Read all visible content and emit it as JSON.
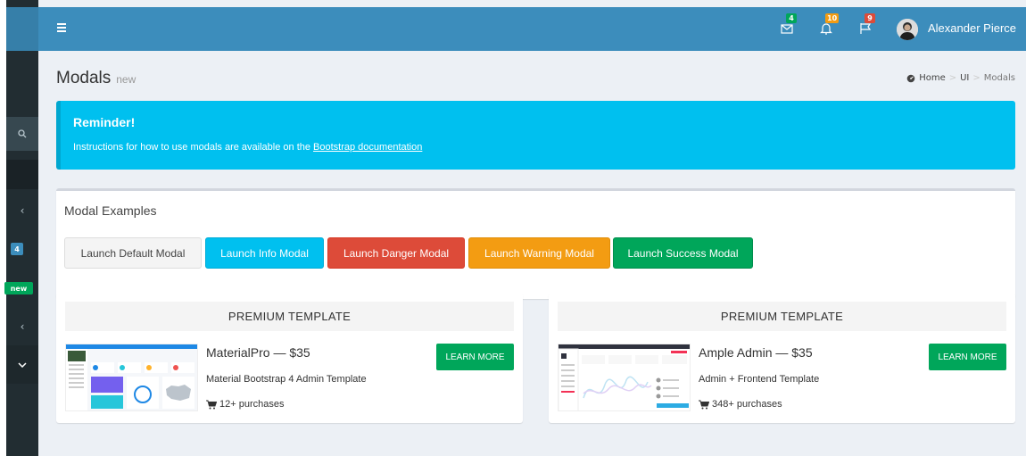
{
  "colors": {
    "navbar": "#3c8dbc",
    "sidebar": "#222d32",
    "info": "#00c0ef",
    "danger": "#dd4b39",
    "warning": "#f39c12",
    "success": "#00a65a",
    "default": "#f4f4f4"
  },
  "sidebar": {
    "search_icon": "search-icon",
    "badge_count": "4",
    "badge_new": "new",
    "chevron": "‹",
    "chevron_down": "⌄"
  },
  "navbar": {
    "messages_badge": "4",
    "notifications_badge": "10",
    "tasks_badge": "9",
    "user_name": "Alexander Pierce"
  },
  "header": {
    "title": "Modals",
    "subtitle": "new",
    "breadcrumb": {
      "home": "Home",
      "ui": "UI",
      "current": "Modals",
      "separator": ">"
    }
  },
  "callout": {
    "title": "Reminder!",
    "text": "Instructions for how to use modals are available on the ",
    "link": "Bootstrap documentation"
  },
  "modal_box": {
    "title": "Modal Examples",
    "buttons": [
      {
        "label": "Launch Default Modal"
      },
      {
        "label": "Launch Info Modal"
      },
      {
        "label": "Launch Danger Modal"
      },
      {
        "label": "Launch Warning Modal"
      },
      {
        "label": "Launch Success Modal"
      }
    ]
  },
  "ads": [
    {
      "header": "PREMIUM TEMPLATE",
      "name": "MaterialPro — $35",
      "description": "Material Bootstrap 4 Admin Template",
      "purchases": "12+ purchases",
      "button": "LEARN MORE"
    },
    {
      "header": "PREMIUM TEMPLATE",
      "name": "Ample Admin — $35",
      "description": "Admin + Frontend Template",
      "purchases": "348+ purchases",
      "button": "LEARN MORE"
    }
  ]
}
